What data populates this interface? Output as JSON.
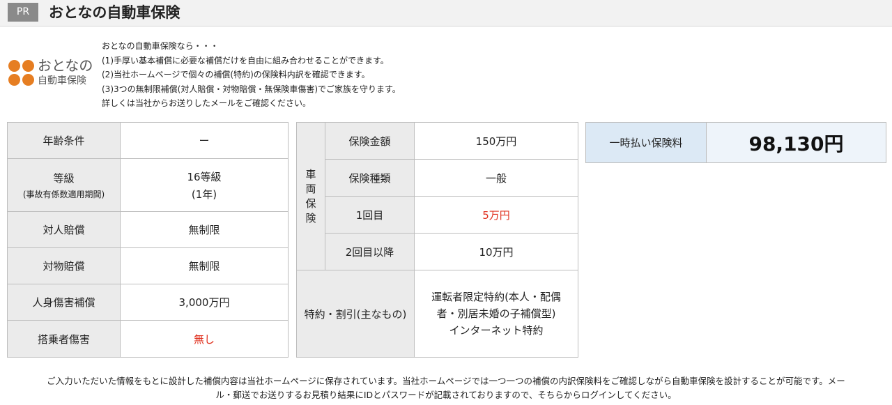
{
  "header": {
    "pr_label": "PR",
    "title": "おとなの自動車保険"
  },
  "logo": {
    "main_text": "おとなの",
    "sub_text": "自動車保険"
  },
  "intro": [
    "おとなの自動車保険なら・・・",
    "(1)手厚い基本補償に必要な補償だけを自由に組み合わせることができます。",
    "(2)当社ホームページで個々の補償(特約)の保険料内訳を確認できます。",
    "(3)3つの無制限補償(対人賠償・対物賠償・無保険車傷害)でご家族を守ります。",
    "詳しくは当社からお送りしたメールをご確認ください。"
  ],
  "table_left": [
    {
      "label": "年齢条件",
      "value": "ー"
    },
    {
      "label": "等級",
      "sublabel": "(事故有係数適用期間)",
      "value": "16等級",
      "subvalue": "(1年)"
    },
    {
      "label": "対人賠償",
      "value": "無制限"
    },
    {
      "label": "対物賠償",
      "value": "無制限"
    },
    {
      "label": "人身傷害補償",
      "value": "3,000万円"
    },
    {
      "label": "搭乗者傷害",
      "value": "無し"
    }
  ],
  "table_middle": {
    "vehicle_group": [
      "車",
      "両",
      "保",
      "険"
    ],
    "rows": [
      {
        "label": "保険金額",
        "value": "150万円"
      },
      {
        "label": "保険種類",
        "value": "一般"
      },
      {
        "label": "1回目",
        "value": "5万円"
      },
      {
        "label": "2回目以降",
        "value": "10万円"
      }
    ],
    "special": {
      "label": "特約・割引(主なもの)",
      "lines": [
        "運転者限定特約(本人・配偶",
        "者・別居未婚の子補償型)",
        "インターネット特約"
      ]
    }
  },
  "premium": {
    "label": "一時払い保険料",
    "value": "98,130円"
  },
  "footer": [
    "ご入力いただいた情報をもとに設計した補償内容は当社ホームページに保存されています。当社ホームページでは一つ一つの補償の内訳保険料をご確認しながら自動車保険を設計することが可能です。メー",
    "ル・郵送でお送りするお見積り結果にIDとパスワードが記載されておりますので、そちらからログインしてください。"
  ],
  "colors": {
    "accent_red": "#e0301e",
    "logo_orange": "#e67e22",
    "premium_label_bg": "#dce9f5",
    "label_bg": "#ebebeb"
  }
}
